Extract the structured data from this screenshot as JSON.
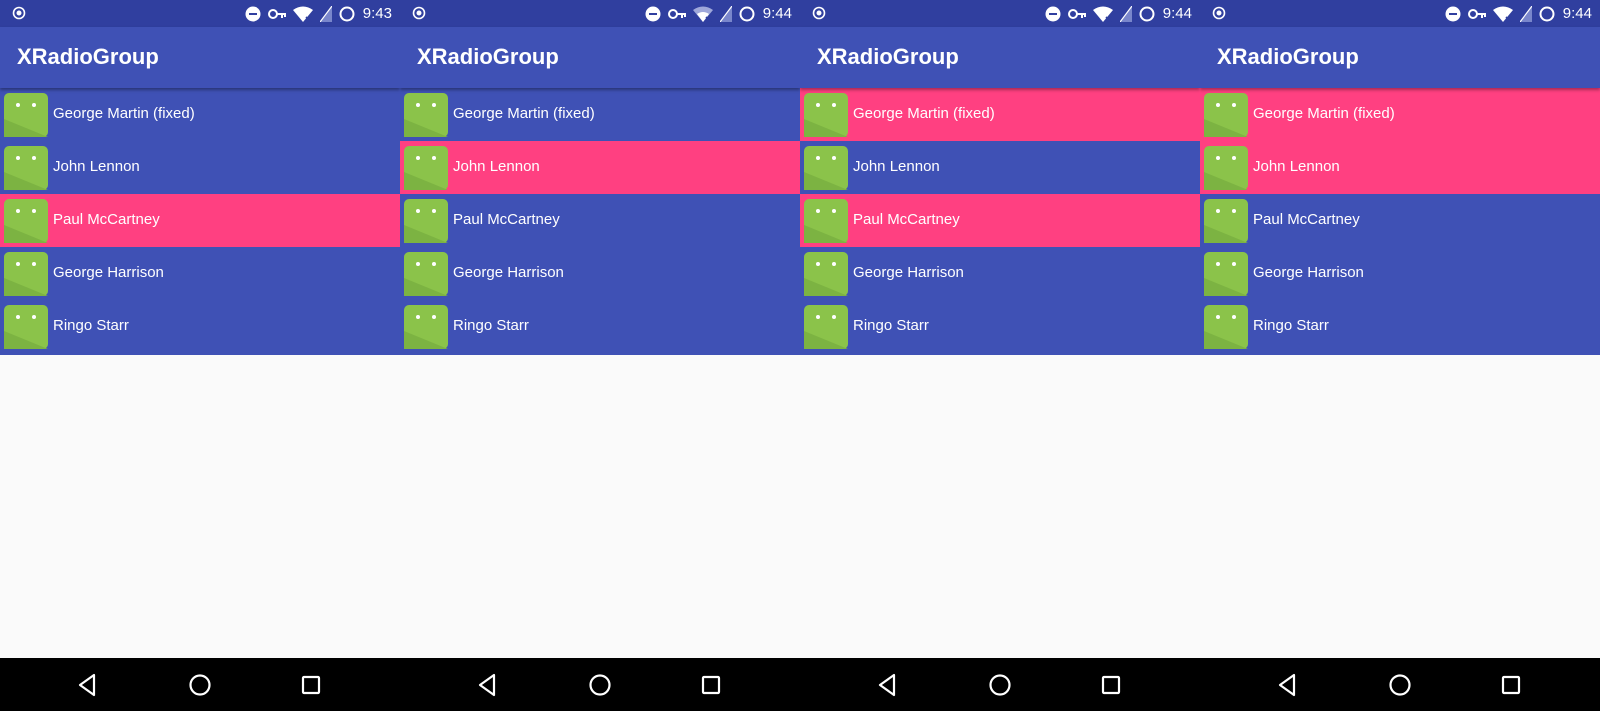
{
  "app_title": "XRadioGroup",
  "colors": {
    "status_bar": "#303f9f",
    "app_bar": "#3f51b5",
    "list_background": "#3f51b5",
    "selected_row": "#ff4081",
    "android_green": "#8bc34a",
    "page_background": "#fafafa",
    "nav_bar": "#000000"
  },
  "icons": {
    "status_left": "record-icon",
    "status_right": [
      "do-not-disturb-icon",
      "vpn-key-icon",
      "wifi-icon",
      "no-sim-icon",
      "circle-icon"
    ],
    "list_avatar": "android-icon",
    "nav": [
      "back-icon",
      "home-icon",
      "recents-icon"
    ]
  },
  "screens": [
    {
      "clock": "9:43",
      "items": [
        {
          "label": "George Martin (fixed)",
          "selected": false
        },
        {
          "label": "John Lennon",
          "selected": false
        },
        {
          "label": "Paul McCartney",
          "selected": true
        },
        {
          "label": "George Harrison",
          "selected": false
        },
        {
          "label": "Ringo Starr",
          "selected": false
        }
      ]
    },
    {
      "clock": "9:44",
      "items": [
        {
          "label": "George Martin (fixed)",
          "selected": false
        },
        {
          "label": "John Lennon",
          "selected": true
        },
        {
          "label": "Paul McCartney",
          "selected": false
        },
        {
          "label": "George Harrison",
          "selected": false
        },
        {
          "label": "Ringo Starr",
          "selected": false
        }
      ]
    },
    {
      "clock": "9:44",
      "items": [
        {
          "label": "George Martin (fixed)",
          "selected": true
        },
        {
          "label": "John Lennon",
          "selected": false
        },
        {
          "label": "Paul McCartney",
          "selected": true
        },
        {
          "label": "George Harrison",
          "selected": false
        },
        {
          "label": "Ringo Starr",
          "selected": false
        }
      ]
    },
    {
      "clock": "9:44",
      "items": [
        {
          "label": "George Martin (fixed)",
          "selected": true
        },
        {
          "label": "John Lennon",
          "selected": true
        },
        {
          "label": "Paul McCartney",
          "selected": false
        },
        {
          "label": "George Harrison",
          "selected": false
        },
        {
          "label": "Ringo Starr",
          "selected": false
        }
      ]
    }
  ]
}
